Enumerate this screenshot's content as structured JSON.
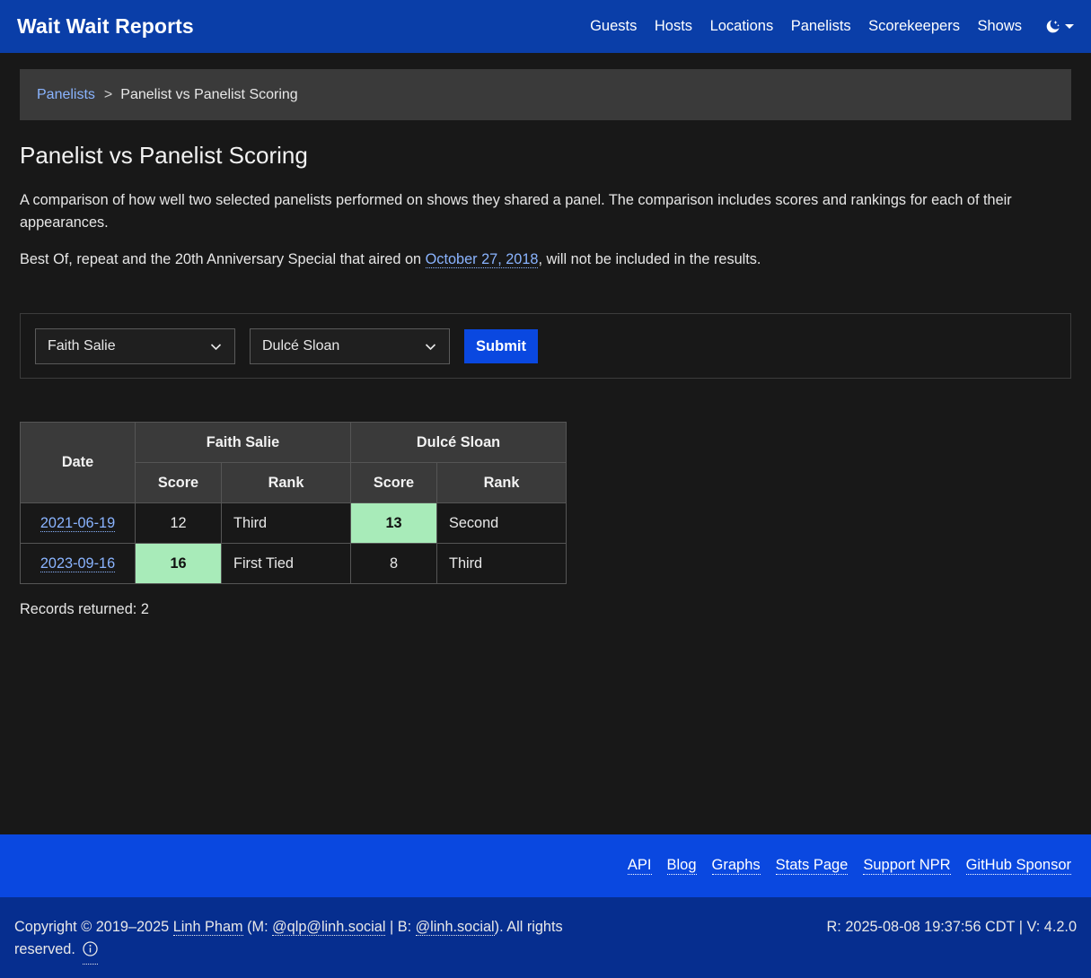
{
  "navbar": {
    "brand": "Wait Wait Reports",
    "links": [
      "Guests",
      "Hosts",
      "Locations",
      "Panelists",
      "Scorekeepers",
      "Shows"
    ],
    "theme_icon": "moon-stars-icon"
  },
  "breadcrumb": {
    "parent": "Panelists",
    "separator": ">",
    "current": "Panelist vs Panelist Scoring"
  },
  "page": {
    "title": "Panelist vs Panelist Scoring",
    "description": "A comparison of how well two selected panelists performed on shows they shared a panel. The comparison includes scores and rankings for each of their appearances.",
    "note_prefix": "Best Of, repeat and the 20th Anniversary Special that aired on ",
    "note_link": "October 27, 2018",
    "note_suffix": ", will not be included in the results."
  },
  "form": {
    "panelist_a": "Faith Salie",
    "panelist_b": "Dulcé Sloan",
    "submit_label": "Submit"
  },
  "table": {
    "date_header": "Date",
    "panelist_a": "Faith Salie",
    "panelist_b": "Dulcé Sloan",
    "score_header": "Score",
    "rank_header": "Rank",
    "rows": [
      {
        "date": "2021-06-19",
        "a_score": "12",
        "a_rank": "Third",
        "b_score": "13",
        "b_rank": "Second",
        "winner": "b"
      },
      {
        "date": "2023-09-16",
        "a_score": "16",
        "a_rank": "First Tied",
        "b_score": "8",
        "b_rank": "Third",
        "winner": "a"
      }
    ],
    "highlight_color": "#a8ebb9"
  },
  "records": "Records returned: 2",
  "footer": {
    "links": [
      "API",
      "Blog",
      "Graphs",
      "Stats Page",
      "Support NPR",
      "GitHub Sponsor"
    ],
    "copyright_prefix": "Copyright © 2019–2025 ",
    "author": "Linh Pham",
    "mastodon_prefix": " (M: ",
    "mastodon": "@qlp@linh.social",
    "bluesky_prefix": " | B: ",
    "bluesky": "@linh.social",
    "copyright_suffix": "). All rights reserved.",
    "info_icon": "info-circle-icon",
    "version": "R: 2025-08-08 19:37:56 CDT | V: 4.2.0"
  },
  "colors": {
    "navbar": "#0a3ea8",
    "footer_links_bar": "#0a48e0",
    "footer_bottom": "#062e8f",
    "submit": "#0a48e0",
    "link": "#8ab4ff"
  }
}
